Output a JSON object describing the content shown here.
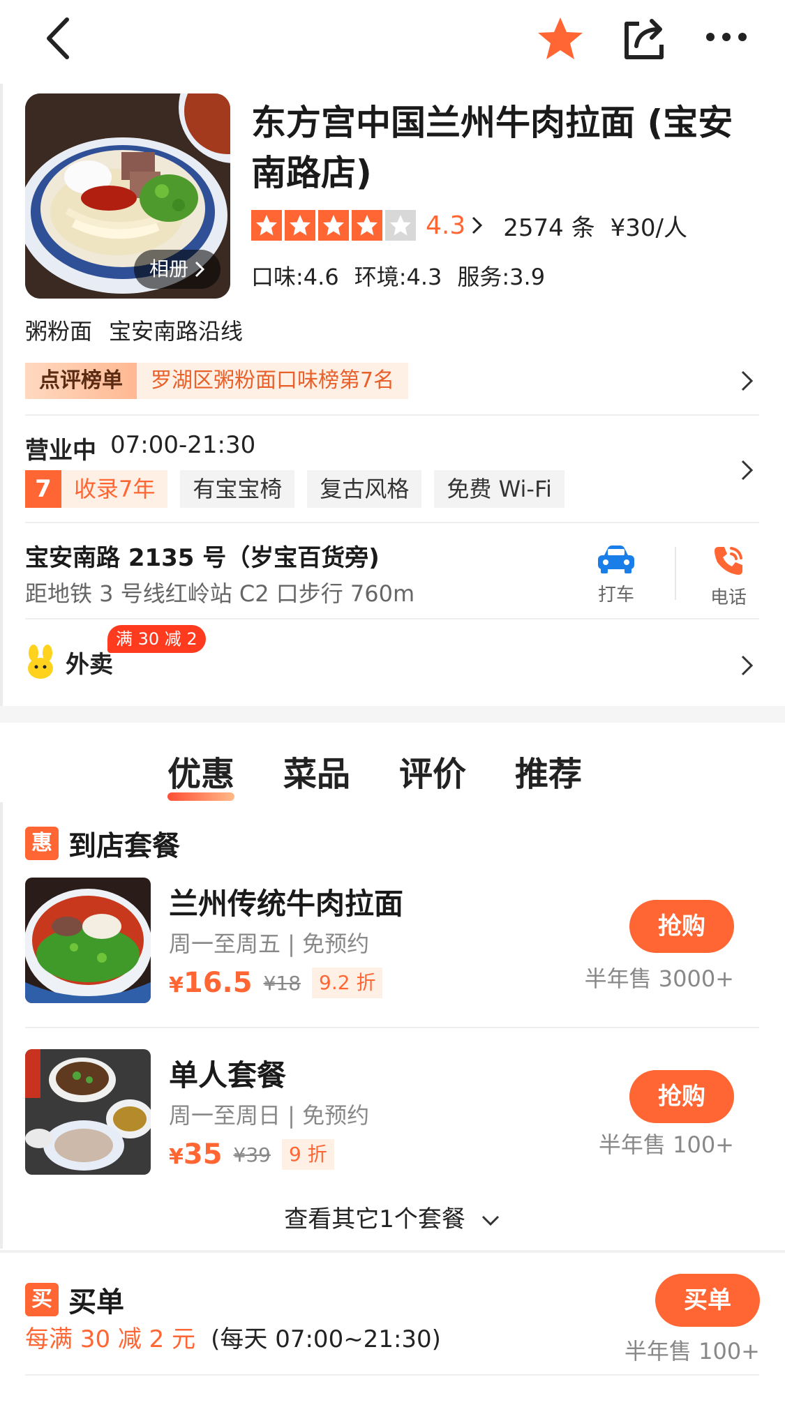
{
  "header": {
    "title": "东方宫中国兰州牛肉拉面 (宝安南路店)",
    "album_label": "相册",
    "rating": "4.3",
    "stars_filled": 4,
    "stars_total": 5,
    "reviews": "2574 条",
    "price": "¥30/人",
    "scores": [
      "口味:4.6",
      "环境:4.3",
      "服务:3.9"
    ],
    "tags": [
      "粥粉面",
      "宝安南路沿线"
    ],
    "rank_label": "点评榜单",
    "rank_text": "罗湖区粥粉面口味榜第7名"
  },
  "info": {
    "status": "营业中",
    "hours": "07:00-21:30",
    "years_num": "7",
    "years_text": "收录7年",
    "features": [
      "有宝宝椅",
      "复古风格",
      "免费 Wi-Fi"
    ],
    "address": "宝安南路 2135 号（岁宝百货旁)",
    "subway": "距地铁 3 号线红岭站 C2 口步行 760m",
    "taxi_label": "打车",
    "phone_label": "电话"
  },
  "delivery": {
    "label": "外卖",
    "badge": "满 30 减 2"
  },
  "tabs": [
    "优惠",
    "菜品",
    "评价",
    "推荐"
  ],
  "packages": {
    "section_icon": "惠",
    "section_title": "到店套餐",
    "items": [
      {
        "name": "兰州传统牛肉拉面",
        "sub": "周一至周五 | 免预约",
        "currency": "¥",
        "price": "16.5",
        "old_price": "¥18",
        "discount": "9.2 折",
        "button": "抢购",
        "sold": "半年售 3000+"
      },
      {
        "name": "单人套餐",
        "sub": "周一至周日 | 免预约",
        "currency": "¥",
        "price": "35",
        "old_price": "¥39",
        "discount": "9 折",
        "button": "抢购",
        "sold": "半年售 100+"
      }
    ],
    "more": "查看其它1个套餐"
  },
  "pay": {
    "section_icon": "买",
    "section_title": "买单",
    "promo": "每满 30 减 2 元",
    "hours": "(每天 07:00~21:30)",
    "button": "买单",
    "sold": "半年售 100+"
  },
  "colors": {
    "accent": "#ff6633",
    "badge_red": "#ff3b1f"
  }
}
